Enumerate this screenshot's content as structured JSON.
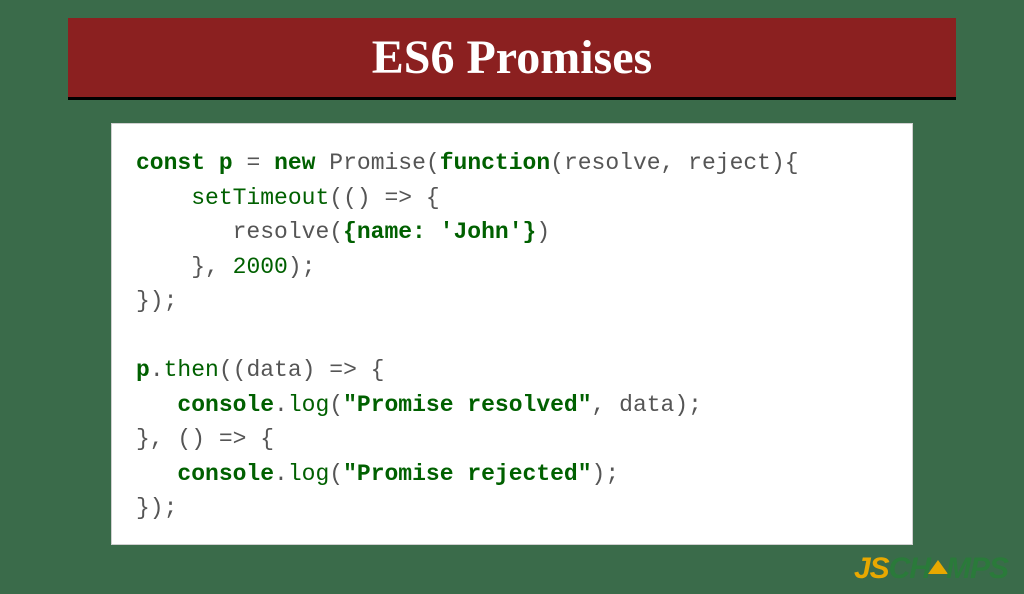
{
  "title": "ES6 Promises",
  "code": {
    "l1_kw_const": "const",
    "l1_var": "p",
    "l1_eq": " = ",
    "l1_kw_new": "new",
    "l1_promise": " Promise(",
    "l1_kw_function": "function",
    "l1_params": "(resolve, reject){",
    "l2_indent": "    ",
    "l2_settimeout": "setTimeout",
    "l2_arrow": "(() => {",
    "l3_indent": "       ",
    "l3_resolve": "resolve(",
    "l3_objstart": "{name:",
    "l3_str": " 'John'",
    "l3_objend": "}",
    "l3_close": ")",
    "l4_indent": "    ",
    "l4_text": "}, ",
    "l4_num": "2000",
    "l4_close": ");",
    "l5": "});",
    "l6": "",
    "l7_var": "p",
    "l7_dot": ".",
    "l7_then": "then",
    "l7_rest": "((data) => {",
    "l8_indent": "   ",
    "l8_console": "console",
    "l8_dot": ".",
    "l8_log": "log",
    "l8_open": "(",
    "l8_str": "\"Promise resolved\"",
    "l8_rest": ", data);",
    "l9": "}, () => {",
    "l10_indent": "   ",
    "l10_console": "console",
    "l10_dot": ".",
    "l10_log": "log",
    "l10_open": "(",
    "l10_str": "\"Promise rejected\"",
    "l10_close": ");",
    "l11": "});"
  },
  "logo": {
    "js": "JS",
    "ch_pre": "CH",
    "ch_post": "MPS"
  }
}
